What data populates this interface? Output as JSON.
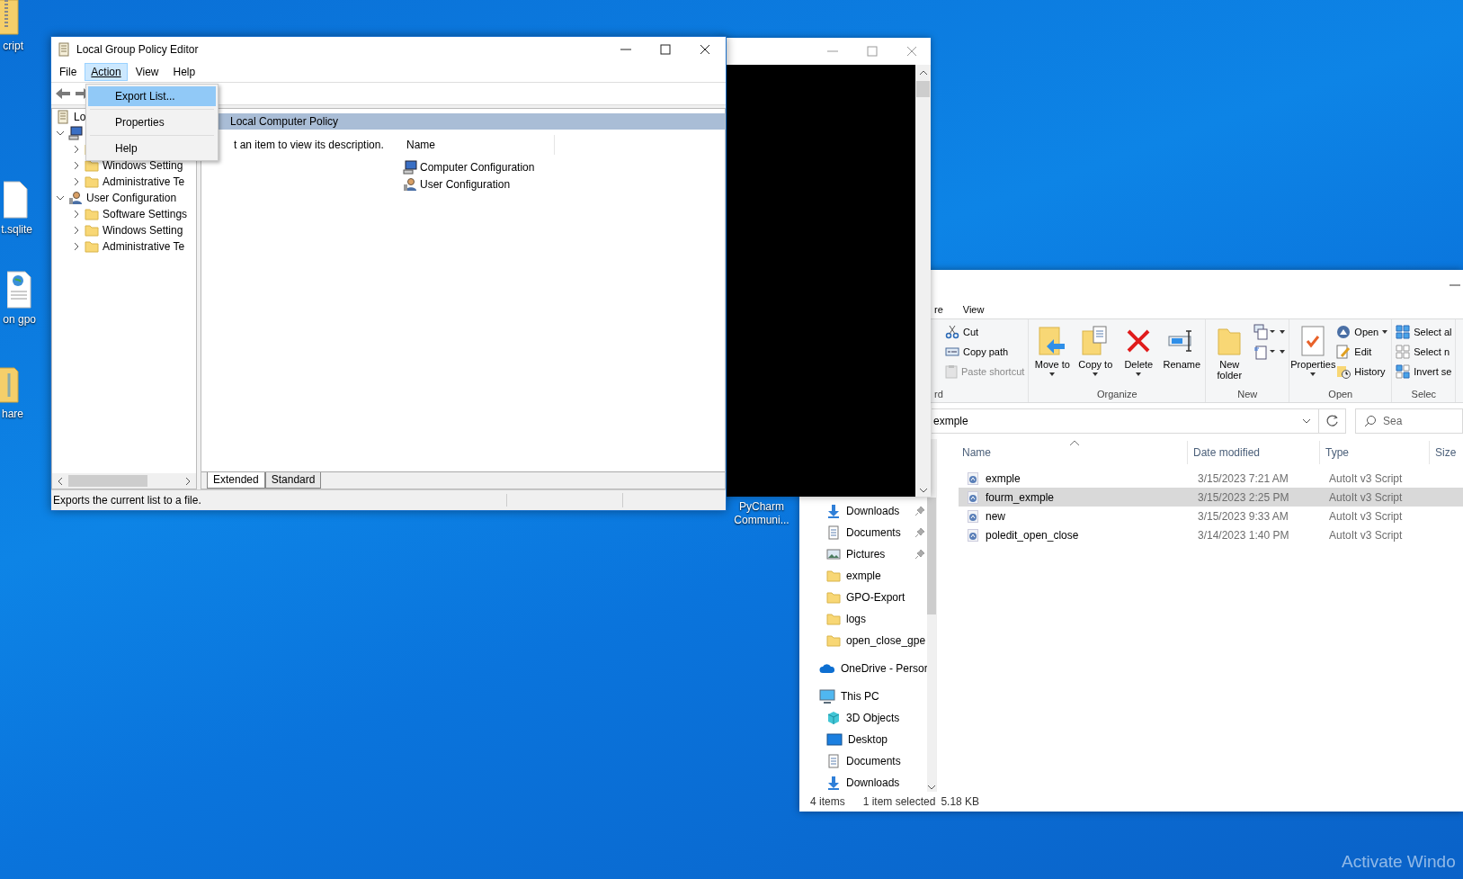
{
  "desktop_icons": [
    {
      "label": "cript",
      "kind": "zip"
    },
    {
      "label": "t.sqlite",
      "kind": "file"
    },
    {
      "label": "on gpo",
      "kind": "web"
    },
    {
      "label": "hare",
      "kind": "folder"
    }
  ],
  "desktop_shortcut_label": [
    "PyCharm",
    "Communi..."
  ],
  "gpo_window": {
    "title": "Local Group Policy Editor",
    "menu": [
      {
        "label": "File",
        "selected": false
      },
      {
        "label": "Action",
        "selected": true
      },
      {
        "label": "View",
        "selected": false
      },
      {
        "label": "Help",
        "selected": false
      }
    ],
    "open_menu": [
      {
        "label": "Export List...",
        "selected": true
      },
      {
        "label": "Properties",
        "selected": false
      },
      {
        "label": "Help",
        "selected": false
      }
    ],
    "tree": [
      {
        "label": "Lo",
        "kind": "policy",
        "children": [
          {
            "kind": "computer",
            "expanded": true,
            "children": [
              {
                "kind": "folder",
                "expanded": false
              },
              {
                "label": "Windows Setting",
                "kind": "folder",
                "expanded": false
              },
              {
                "label": "Administrative Te",
                "kind": "folder",
                "expanded": false
              }
            ]
          },
          {
            "label": "User Configuration",
            "kind": "user",
            "expanded": true,
            "children": [
              {
                "label": "Software Settings",
                "kind": "folder",
                "expanded": false
              },
              {
                "label": "Windows Setting",
                "kind": "folder",
                "expanded": false
              },
              {
                "label": "Administrative Te",
                "kind": "folder",
                "expanded": false
              }
            ]
          }
        ]
      }
    ],
    "pane_header": "Local Computer Policy",
    "description": "t an item to view its description.",
    "list_column": "Name",
    "list_items": [
      {
        "label": "Computer Configuration",
        "kind": "computer"
      },
      {
        "label": "User Configuration",
        "kind": "user"
      }
    ],
    "view_tabs": [
      {
        "label": "Extended",
        "selected": true
      },
      {
        "label": "Standard",
        "selected": false
      }
    ],
    "status": "Exports the current list to a file."
  },
  "explorer_window": {
    "ribbon_tabs": [
      "re",
      "View"
    ],
    "ribbon_groups": [
      {
        "label": "rd",
        "items": [
          {
            "kind": "stack",
            "buttons": [
              {
                "label": "Cut",
                "disabled": false,
                "dropdown": false
              },
              {
                "label": "Copy path",
                "disabled": false,
                "dropdown": false
              },
              {
                "label": "Paste shortcut",
                "disabled": true,
                "dropdown": false
              }
            ]
          }
        ]
      },
      {
        "label": "Organize",
        "items": [
          {
            "kind": "large",
            "label": "Move to",
            "dropdown": true
          },
          {
            "kind": "large",
            "label": "Copy to",
            "dropdown": true
          },
          {
            "kind": "large",
            "label": "Delete",
            "dropdown": true
          },
          {
            "kind": "large",
            "label": "Rename",
            "dropdown": false
          }
        ]
      },
      {
        "label": "New",
        "items": [
          {
            "kind": "large",
            "label": "New folder",
            "dropdown": false
          },
          {
            "kind": "stack",
            "buttons": [
              {
                "disabled": false,
                "dropdown": true
              },
              {
                "disabled": false,
                "dropdown": true
              }
            ]
          }
        ]
      },
      {
        "label": "Open",
        "items": [
          {
            "kind": "large",
            "label": "Properties",
            "dropdown": true
          },
          {
            "kind": "stack",
            "buttons": [
              {
                "label": "Open",
                "disabled": false,
                "dropdown": true
              },
              {
                "label": "Edit",
                "disabled": false,
                "dropdown": false
              },
              {
                "label": "History",
                "disabled": false,
                "dropdown": false
              }
            ]
          }
        ]
      },
      {
        "label": "Selec",
        "items": [
          {
            "kind": "stack",
            "buttons": [
              {
                "label": "Select al",
                "disabled": false,
                "dropdown": false
              },
              {
                "label": "Select n",
                "disabled": false,
                "dropdown": false
              },
              {
                "label": "Invert se",
                "disabled": false,
                "dropdown": false
              }
            ]
          }
        ]
      }
    ],
    "address": "exmple",
    "search_placeholder": "Sea",
    "columns": [
      "Name",
      "Date modified",
      "Type",
      "Size"
    ],
    "files": [
      {
        "name": "exmple",
        "date": "3/15/2023 7:21 AM",
        "type": "AutoIt v3 Script",
        "selected": false
      },
      {
        "name": "fourm_exmple",
        "date": "3/15/2023 2:25 PM",
        "type": "AutoIt v3 Script",
        "selected": true
      },
      {
        "name": "new",
        "date": "3/15/2023 9:33 AM",
        "type": "AutoIt v3 Script",
        "selected": false
      },
      {
        "name": "poledit_open_close",
        "date": "3/14/2023 1:40 PM",
        "type": "AutoIt v3 Script",
        "selected": false
      }
    ],
    "nav": [
      {
        "children": [
          {
            "label": "Downloads",
            "kind": "downloads",
            "pinned": true
          },
          {
            "label": "Documents",
            "kind": "documents",
            "pinned": true
          },
          {
            "label": "Pictures",
            "kind": "pictures",
            "pinned": true
          },
          {
            "label": "exmple",
            "kind": "folder",
            "pinned": false
          },
          {
            "label": "GPO-Export",
            "kind": "folder",
            "pinned": false
          },
          {
            "label": "logs",
            "kind": "folder",
            "pinned": false
          },
          {
            "label": "open_close_gpe",
            "kind": "folder",
            "pinned": false
          }
        ]
      },
      {
        "label": "OneDrive - Persor",
        "kind": "cloud"
      },
      {
        "label": "This PC",
        "kind": "pc",
        "children": [
          {
            "label": "3D Objects",
            "kind": "cube"
          },
          {
            "label": "Desktop",
            "kind": "desktop"
          },
          {
            "label": "Documents",
            "kind": "documents"
          },
          {
            "label": "Downloads",
            "kind": "downloads"
          }
        ]
      }
    ],
    "status": [
      "4 items",
      "1 item selected",
      "5.18 KB"
    ]
  },
  "activation_notice": "Activate Windo"
}
